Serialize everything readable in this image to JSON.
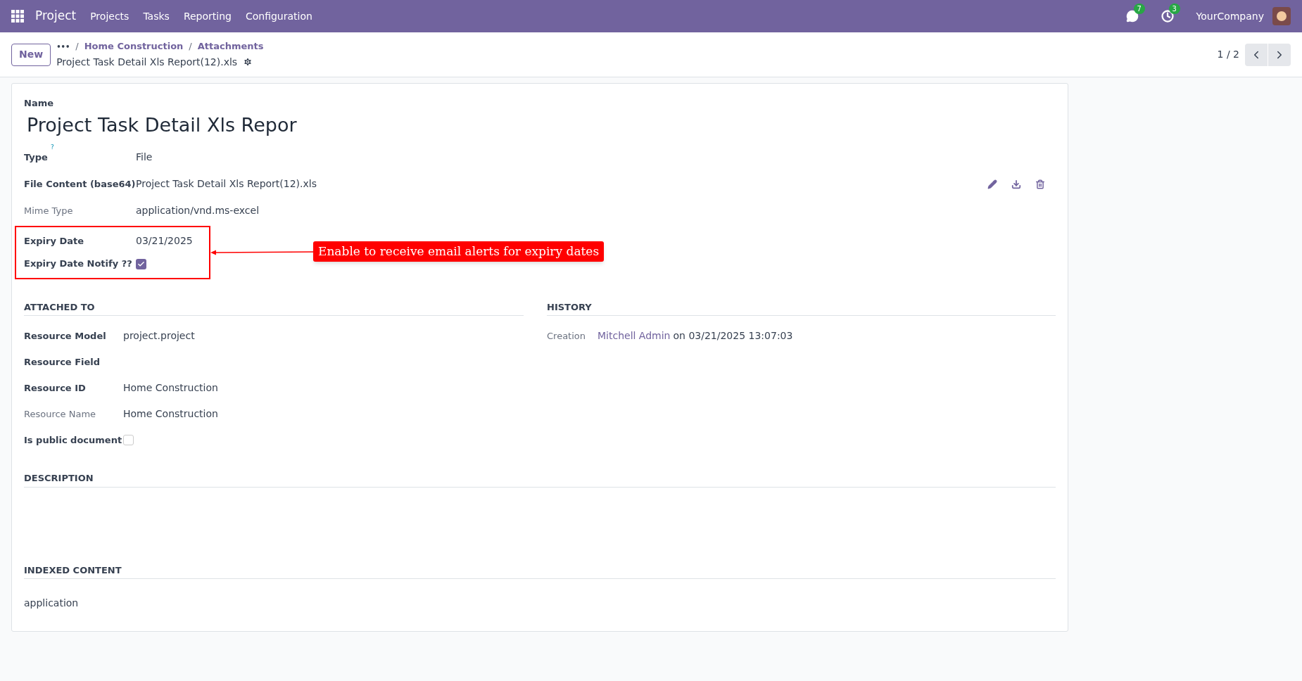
{
  "navbar": {
    "app": "Project",
    "menu": [
      "Projects",
      "Tasks",
      "Reporting",
      "Configuration"
    ],
    "messages_badge": "7",
    "activities_badge": "3",
    "company": "YourCompany"
  },
  "control_panel": {
    "new_button": "New",
    "breadcrumb_more": "•••",
    "breadcrumbs": [
      {
        "separator": "/",
        "label": "Home Construction"
      },
      {
        "separator": "/",
        "label": "Attachments"
      }
    ],
    "record_title": "Project Task Detail Xls Report(12).xls",
    "pager": "1 / 2"
  },
  "form": {
    "name_label": "Name",
    "name_value": "Project Task Detail Xls Repor",
    "fields": [
      {
        "label": "Type",
        "help": "?",
        "value": "File",
        "bold": true
      },
      {
        "label": "File Content (base64)",
        "value": "Project Task Detail Xls Report(12).xls",
        "bold": true
      },
      {
        "label": "Mime Type",
        "value": "application/vnd.ms-excel",
        "bold": false
      }
    ],
    "expiry": {
      "date_label": "Expiry Date",
      "date_value": "03/21/2025",
      "notify_label": "Expiry Date Notify ??",
      "notify_checked": true,
      "annotation": "Enable to receive email alerts for expiry dates"
    },
    "attached_to": {
      "title": "ATTACHED TO",
      "fields": [
        {
          "label": "Resource Model",
          "value": "project.project",
          "kind": "text",
          "bold": true
        },
        {
          "label": "Resource Field",
          "kind": "text",
          "bold": true
        },
        {
          "label": "Resource ID",
          "value": "Home Construction",
          "kind": "text",
          "bold": true
        },
        {
          "label": "Resource Name",
          "value": "Home Construction",
          "kind": "text",
          "bold": false
        },
        {
          "label": "Is public document",
          "kind": "checkbox",
          "checked": false,
          "bold": true
        }
      ]
    },
    "history": {
      "title": "HISTORY",
      "label": "Creation",
      "user": "Mitchell Admin",
      "rest": "on 03/21/2025 13:07:03"
    },
    "description": {
      "title": "DESCRIPTION"
    },
    "indexed_content": {
      "title": "INDEXED CONTENT",
      "value": "application"
    }
  }
}
